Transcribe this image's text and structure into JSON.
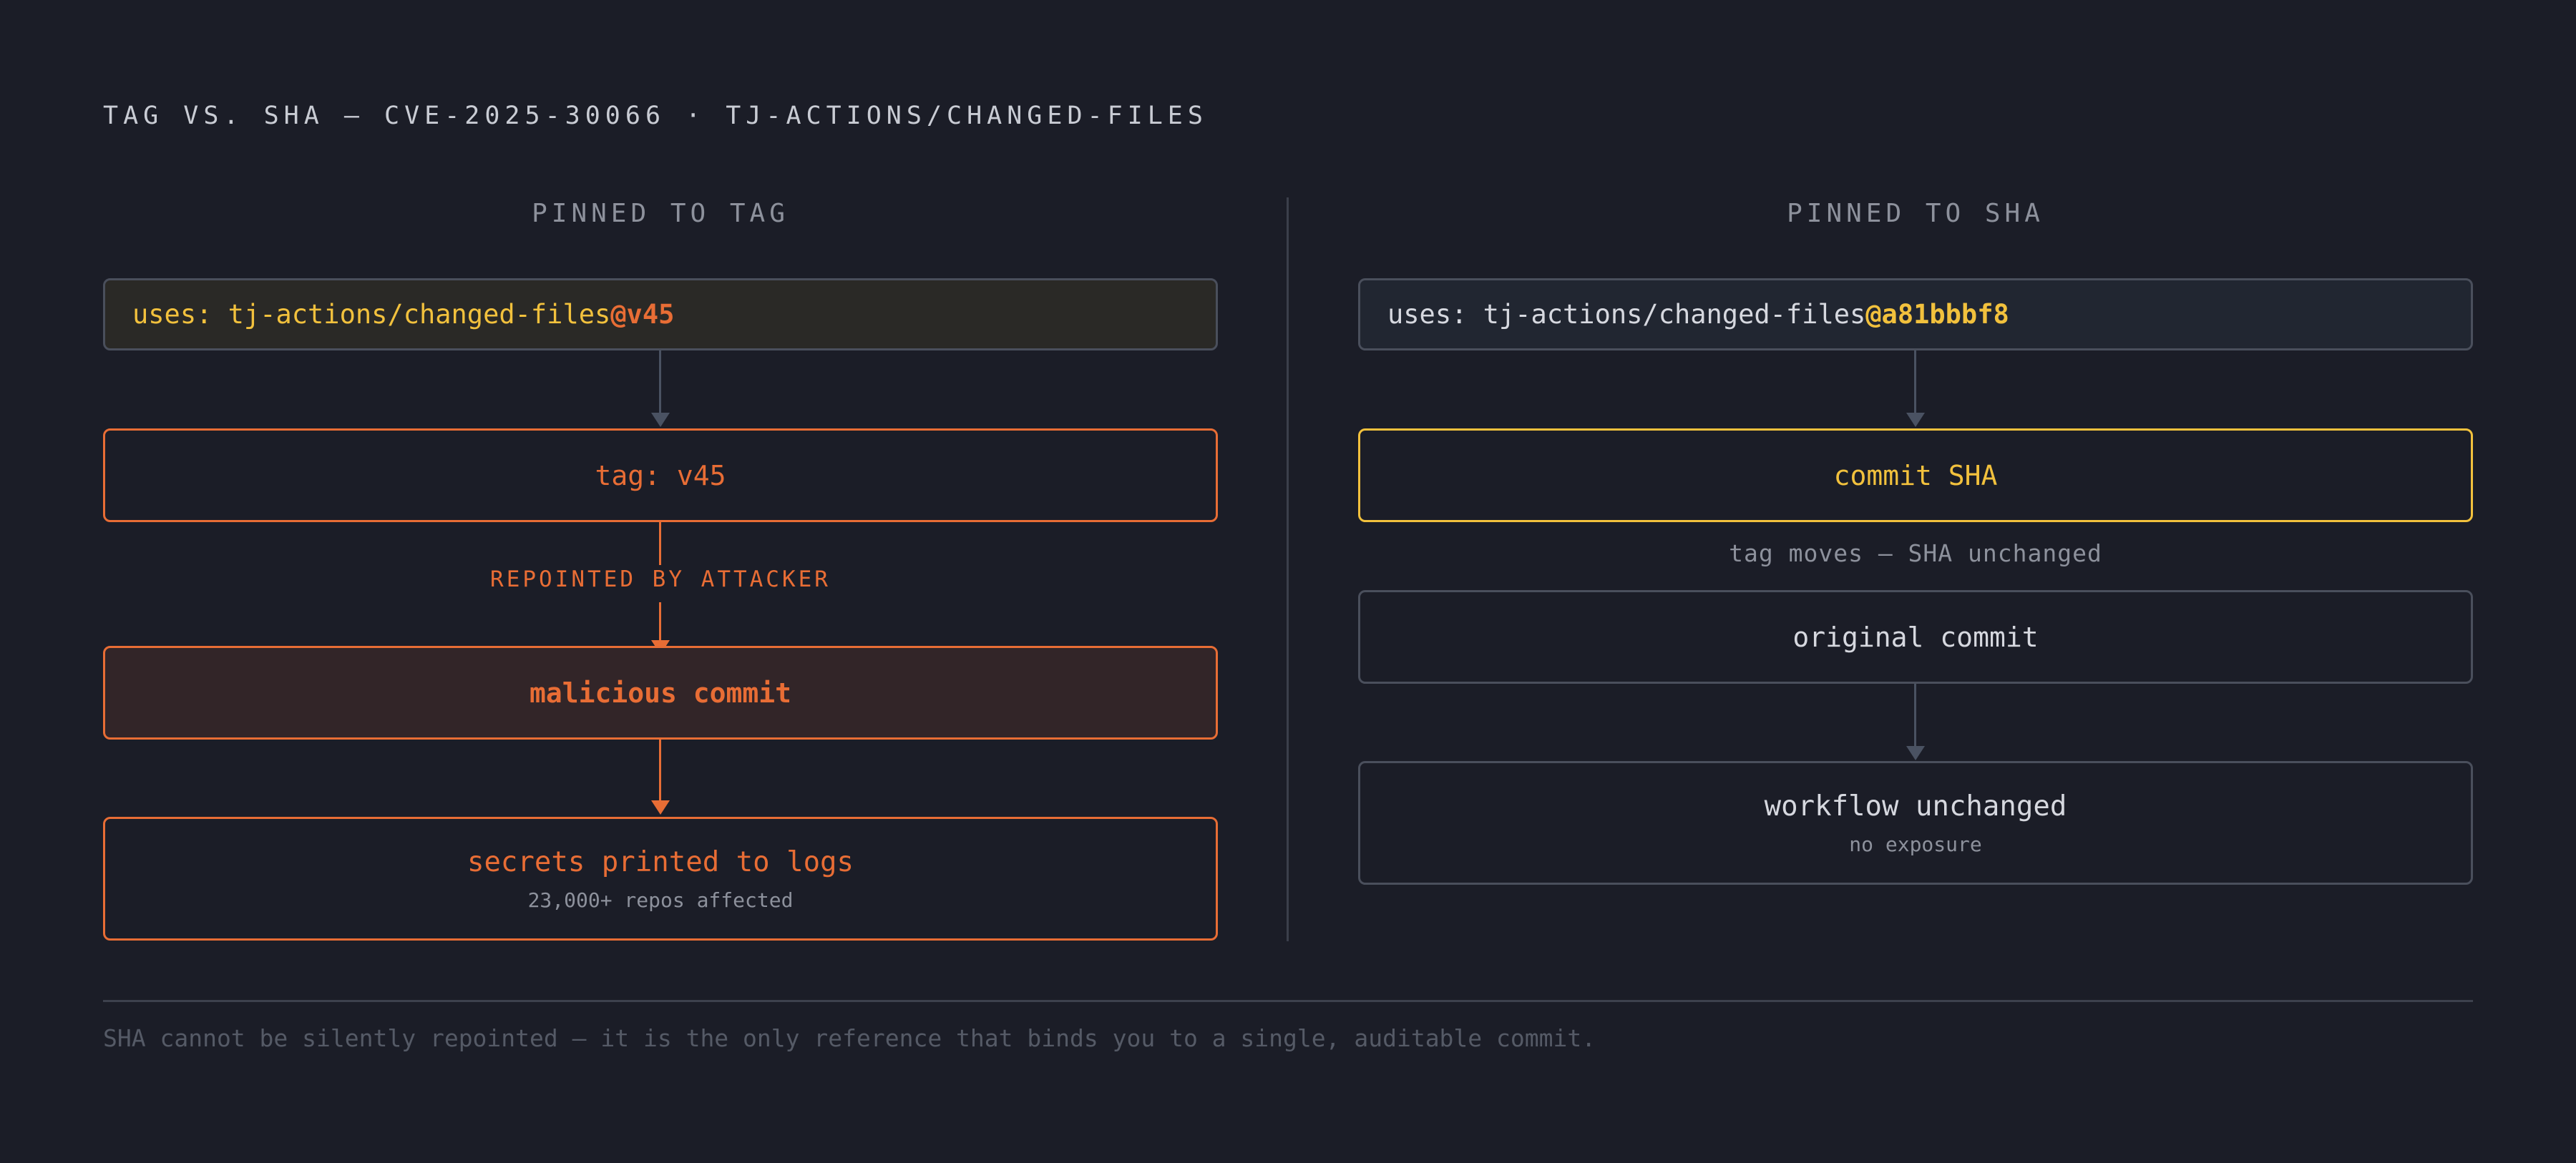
{
  "header": {
    "title": "TAG VS. SHA — CVE-2025-30066 · TJ-ACTIONS/CHANGED-FILES"
  },
  "left": {
    "heading": "PINNED TO TAG",
    "uses_prefix": "uses: tj-actions/changed-files",
    "uses_ref": "@v45",
    "tag_label": "tag: v45",
    "repoint_label": "REPOINTED BY ATTACKER",
    "malicious_label": "malicious commit",
    "secrets_label": "secrets printed to logs",
    "secrets_sub": "23,000+ repos affected"
  },
  "right": {
    "heading": "PINNED TO SHA",
    "uses_prefix": "uses: tj-actions/changed-files",
    "uses_ref": "@a81bbbf8",
    "commit_label": "commit SHA",
    "note": "tag moves — SHA unchanged",
    "original_label": "original commit",
    "workflow_label": "workflow unchanged",
    "workflow_sub": "no exposure"
  },
  "footer": {
    "text": "SHA cannot be silently repointed — it is the only reference that binds you to a single, auditable commit."
  },
  "colors": {
    "background": "#1b1d27",
    "orange": "#e86d35",
    "yellow": "#f2c13d",
    "neutral_border": "#4a4f5c",
    "muted_text": "#8d919c"
  }
}
